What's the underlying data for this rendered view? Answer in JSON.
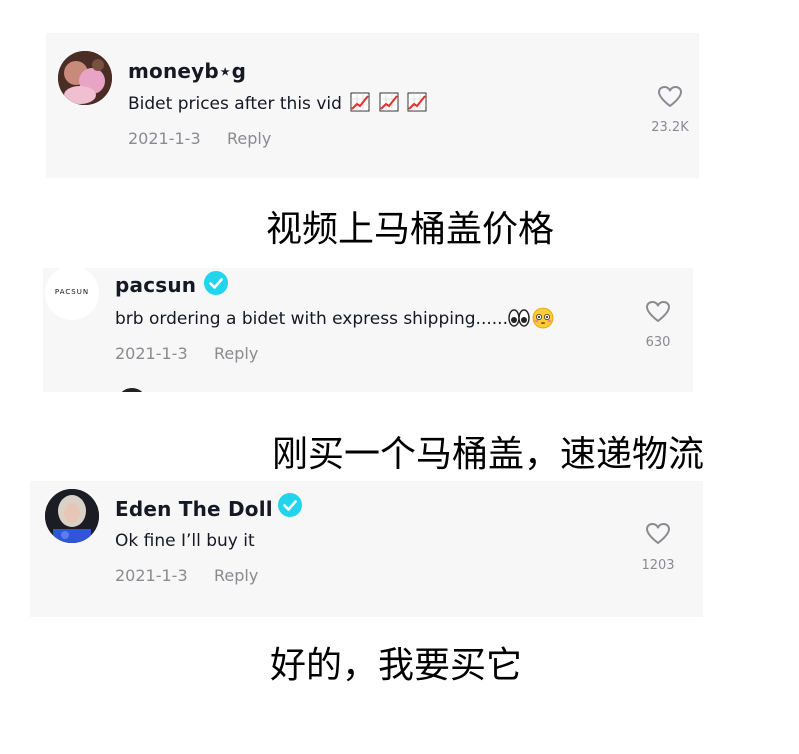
{
  "comments": [
    {
      "username": "moneyb⋆g",
      "text": "Bidet prices after this vid",
      "emojis": [
        "chart-increasing",
        "chart-increasing",
        "chart-increasing"
      ],
      "date": "2021-1-3",
      "reply_label": "Reply",
      "likes": "23.2K",
      "verified": false
    },
    {
      "username": "pacsun",
      "avatar_text": "PACSUN",
      "text": "brb ordering a bidet with express shipping......",
      "emojis": [
        "eyes",
        "flushed-face"
      ],
      "date": "2021-1-3",
      "reply_label": "Reply",
      "likes": "630",
      "verified": true
    },
    {
      "username": "Eden The Doll",
      "text": "Ok fine I’ll buy it",
      "date": "2021-1-3",
      "reply_label": "Reply",
      "likes": "1203",
      "verified": true
    }
  ],
  "captions": [
    "视频上马桶盖价格",
    "刚买一个马桶盖，速递物流",
    "好的，我要买它"
  ],
  "colors": {
    "card_bg": "#f7f7f7",
    "text": "#161823",
    "muted": "#8a8b91",
    "verified": "#20d5ec"
  }
}
